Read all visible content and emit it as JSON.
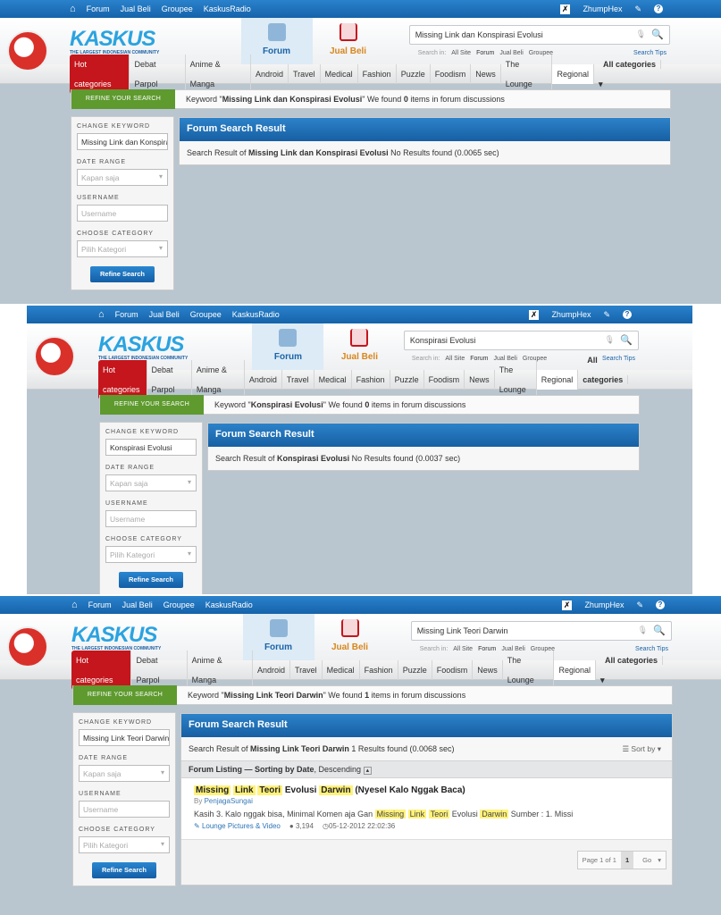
{
  "panels": [
    {
      "nav": [
        "Forum",
        "Jual Beli",
        "Groupee",
        "KaskusRadio"
      ],
      "user": "ZhumpHex",
      "logo": "KASKUS",
      "tagline": "THE LARGEST INDONESIAN COMMUNITY",
      "tab_forum": "Forum",
      "tab_jualbeli": "Jual Beli",
      "search_value": "Missing Link dan Konspirasi Evolusi",
      "search_in_label": "Search in:",
      "search_in": [
        "All Site",
        "Forum",
        "Jual Beli",
        "Groupee"
      ],
      "search_tips": "Search Tips",
      "categories": [
        "Hot categories",
        "Debat Parpol",
        "Anime & Manga",
        "Android",
        "Travel",
        "Medical",
        "Fashion",
        "Puzzle",
        "Foodism",
        "News",
        "The Lounge",
        "Regional"
      ],
      "all_categories": "All categories",
      "refine_label": "REFINE YOUR SEARCH",
      "keyword_pre": "Keyword \"",
      "keyword": "Missing Link dan Konspirasi Evolusi",
      "keyword_mid": "\" We found ",
      "count": "0",
      "keyword_post": " items in forum discussions",
      "sidebar": {
        "change_keyword": "CHANGE KEYWORD",
        "keyword_value": "Missing Link dan Konspirasi Evolusi",
        "date_range": "DATE RANGE",
        "date_value": "Kapan saja",
        "username": "USERNAME",
        "username_placeholder": "Username",
        "category": "CHOOSE CATEGORY",
        "category_value": "Pilih Kategori",
        "button": "Refine Search"
      },
      "result_title": "Forum Search Result",
      "result_pre": "Search Result of ",
      "result_kw": "Missing Link dan Konspirasi Evolusi",
      "result_post": " No Results found (0.0065 sec)"
    },
    {
      "nav": [
        "Forum",
        "Jual Beli",
        "Groupee",
        "KaskusRadio"
      ],
      "user": "ZhumpHex",
      "logo": "KASKUS",
      "tagline": "THE LARGEST INDONESIAN COMMUNITY",
      "tab_forum": "Forum",
      "tab_jualbeli": "Jual Beli",
      "search_value": "Konspirasi Evolusi",
      "search_in_label": "Search in:",
      "search_in": [
        "All Site",
        "Forum",
        "Jual Beli",
        "Groupee"
      ],
      "search_tips": "Search Tips",
      "categories": [
        "Hot categories",
        "Debat Parpol",
        "Anime & Manga",
        "Android",
        "Travel",
        "Medical",
        "Fashion",
        "Puzzle",
        "Foodism",
        "News",
        "The Lounge",
        "Regional"
      ],
      "all_categories": "All categories",
      "refine_label": "REFINE YOUR SEARCH",
      "keyword_pre": "Keyword \"",
      "keyword": "Konspirasi Evolusi",
      "keyword_mid": "\" We found ",
      "count": "0",
      "keyword_post": " items in forum discussions",
      "sidebar": {
        "change_keyword": "CHANGE KEYWORD",
        "keyword_value": "Konspirasi Evolusi",
        "date_range": "DATE RANGE",
        "date_value": "Kapan saja",
        "username": "USERNAME",
        "username_placeholder": "Username",
        "category": "CHOOSE CATEGORY",
        "category_value": "Pilih Kategori",
        "button": "Refine Search"
      },
      "result_title": "Forum Search Result",
      "result_pre": "Search Result of ",
      "result_kw": "Konspirasi Evolusi",
      "result_post": " No Results found (0.0037 sec)"
    },
    {
      "nav": [
        "Forum",
        "Jual Beli",
        "Groupee",
        "KaskusRadio"
      ],
      "user": "ZhumpHex",
      "logo": "KASKUS",
      "tagline": "THE LARGEST INDONESIAN COMMUNITY",
      "tab_forum": "Forum",
      "tab_jualbeli": "Jual Beli",
      "search_value": "Missing Link Teori Darwin",
      "search_in_label": "Search in:",
      "search_in": [
        "All Site",
        "Forum",
        "Jual Beli",
        "Groupee"
      ],
      "search_tips": "Search Tips",
      "categories": [
        "Hot categories",
        "Debat Parpol",
        "Anime & Manga",
        "Android",
        "Travel",
        "Medical",
        "Fashion",
        "Puzzle",
        "Foodism",
        "News",
        "The Lounge",
        "Regional"
      ],
      "all_categories": "All categories",
      "refine_label": "REFINE YOUR SEARCH",
      "keyword_pre": "Keyword \"",
      "keyword": "Missing Link Teori Darwin",
      "keyword_mid": "\" We found ",
      "count": "1",
      "keyword_post": " items in forum discussions",
      "sidebar": {
        "change_keyword": "CHANGE KEYWORD",
        "keyword_value": "Missing Link Teori Darwin",
        "date_range": "DATE RANGE",
        "date_value": "Kapan saja",
        "username": "USERNAME",
        "username_placeholder": "Username",
        "category": "CHOOSE CATEGORY",
        "category_value": "Pilih Kategori",
        "button": "Refine Search"
      },
      "result_title": "Forum Search Result",
      "result_pre": "Search Result of ",
      "result_kw": "Missing Link Teori Darwin",
      "result_post": " 1 Results found (0.0068 sec)",
      "sort_by": "Sort by",
      "listing": {
        "pre": "Forum Listing — Sorting by ",
        "field": "Date",
        "post": ", Descending"
      },
      "thread": {
        "title_words": [
          {
            "t": "Missing",
            "hl": true
          },
          {
            "t": "Link",
            "hl": true
          },
          {
            "t": "Teori",
            "hl": true
          },
          {
            "t": "Evolusi",
            "hl": false
          },
          {
            "t": "Darwin",
            "hl": true
          },
          {
            "t": "(Nyesel Kalo Nggak Baca)",
            "hl": false
          }
        ],
        "by": "By",
        "author": "PenjagaSungai",
        "snippet_words": [
          {
            "t": "Kasih 3. Kalo nggak bisa, Minimal Komen aja Gan",
            "hl": false
          },
          {
            "t": "Missing",
            "hl": true
          },
          {
            "t": "Link",
            "hl": true
          },
          {
            "t": "Teori",
            "hl": true
          },
          {
            "t": "Evolusi",
            "hl": false
          },
          {
            "t": "Darwin",
            "hl": true
          },
          {
            "t": "Sumber : 1. Missi",
            "hl": false
          }
        ],
        "forum": "Lounge Pictures & Video",
        "replies": "3,194",
        "date": "05-12-2012 22:02:36"
      },
      "pager": {
        "label": "Page 1 of 1",
        "current": "1",
        "go": "Go"
      }
    }
  ]
}
